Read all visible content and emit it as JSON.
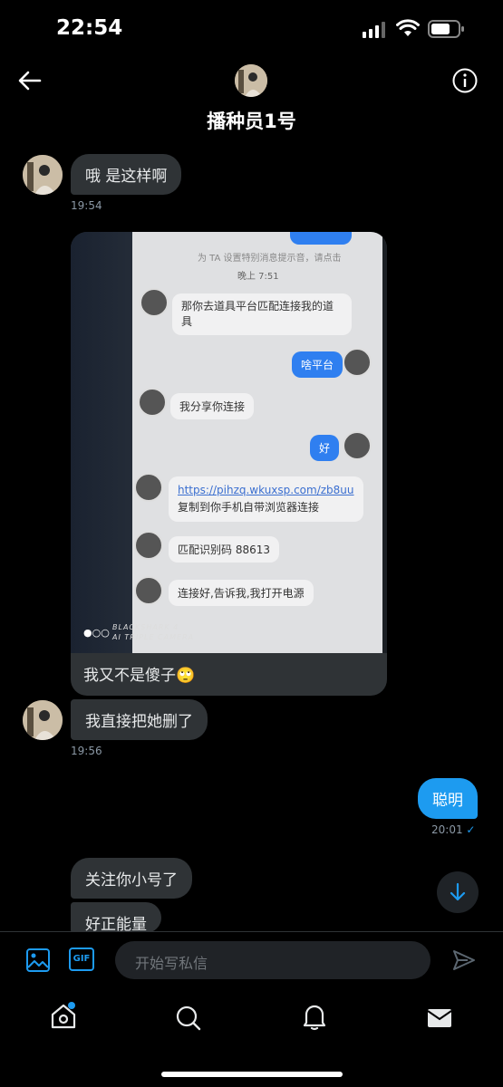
{
  "status_bar": {
    "time": "22:54"
  },
  "header": {
    "name": "播种员1号"
  },
  "messages": {
    "m1": {
      "text": "哦 是这样啊",
      "time": "19:54"
    },
    "photo": {
      "screenshot": {
        "notice": "为 TA 设置特别消息提示音，请点击",
        "time": "晚上 7:51",
        "msg1": "那你去道具平台匹配连接我的道具",
        "reply1": "啥平台",
        "msg2": "我分享你连接",
        "reply2": "好",
        "link": "https://pihzq.wkuxsp.com/zb8uu",
        "link_hint": "复制到你手机自带浏览器连接",
        "code": "匹配识别码 88613",
        "msg3": "连接好,告诉我,我打开电源",
        "watermark_1": "BLACKSHARK 4",
        "watermark_2": "AI TRIPLE CAMERA"
      },
      "caption": "我又不是傻子🙄"
    },
    "m2": {
      "text": "我直接把她删了",
      "time": "19:56"
    },
    "out1": {
      "text": "聪明",
      "time": "20:01",
      "read_mark": "✓"
    },
    "m3": {
      "text": "关注你小号了"
    },
    "m4": {
      "text": "好正能量"
    }
  },
  "composer": {
    "placeholder": "开始写私信",
    "gif_label": "GIF"
  },
  "colors": {
    "accent": "#1d9bf0",
    "bubble_in": "#2f3336",
    "background": "#000000"
  }
}
